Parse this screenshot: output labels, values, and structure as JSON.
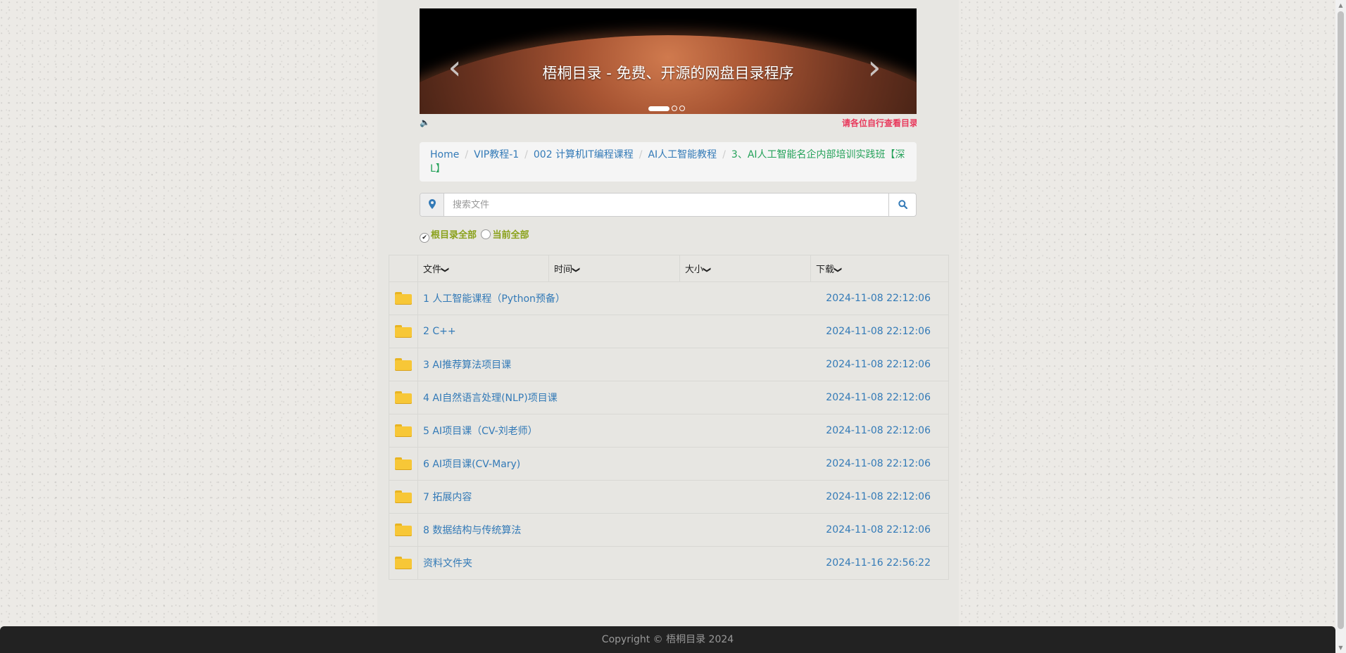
{
  "banner": {
    "caption": "梧桐目录 - 免费、开源的网盘目录程序",
    "prev_glyph": "‹",
    "next_glyph": "›",
    "slide_count": 3,
    "active_slide": 1
  },
  "notice": {
    "text": "请各位自行查看目录"
  },
  "breadcrumb": [
    {
      "label": "Home"
    },
    {
      "label": "VIP教程-1"
    },
    {
      "label": "002 计算机IT编程课程"
    },
    {
      "label": "AI人工智能教程"
    },
    {
      "label": "3、AI人工智能名企内部培训实践班【深L】",
      "active": true
    }
  ],
  "search": {
    "placeholder": "搜索文件",
    "value": ""
  },
  "options": {
    "root_all": "根目录全部",
    "current_all": "当前全部",
    "root_all_checked": true,
    "current_all_checked": false
  },
  "table": {
    "headers": {
      "file": "文件",
      "time": "时间",
      "size": "大小",
      "download": "下载"
    },
    "rows": [
      {
        "name": "1 人工智能课程（Python预备）",
        "date": "2024-11-08 22:12:06"
      },
      {
        "name": "2 C++",
        "date": "2024-11-08 22:12:06"
      },
      {
        "name": "3 AI推荐算法项目课",
        "date": "2024-11-08 22:12:06"
      },
      {
        "name": "4 AI自然语言处理(NLP)项目课",
        "date": "2024-11-08 22:12:06"
      },
      {
        "name": "5 AI项目课（CV-刘老师）",
        "date": "2024-11-08 22:12:06"
      },
      {
        "name": "6 AI项目课(CV-Mary)",
        "date": "2024-11-08 22:12:06"
      },
      {
        "name": "7 拓展内容",
        "date": "2024-11-08 22:12:06"
      },
      {
        "name": "8 数据结构与传统算法",
        "date": "2024-11-08 22:12:06"
      },
      {
        "name": "资料文件夹",
        "date": "2024-11-16 22:56:22"
      }
    ]
  },
  "footer": {
    "text": "Copyright © 梧桐目录 2024"
  },
  "colors": {
    "link": "#337ab7",
    "active_crumb": "#25a25a",
    "notice": "#e8385b",
    "option": "#8aa11a",
    "folder": "#f7c737",
    "footer_bg": "#222222"
  },
  "icons": {
    "speaker": "speaker-icon",
    "location": "map-marker-icon",
    "search": "search-icon",
    "folder": "folder-icon",
    "caret": "chevron-down-icon"
  }
}
